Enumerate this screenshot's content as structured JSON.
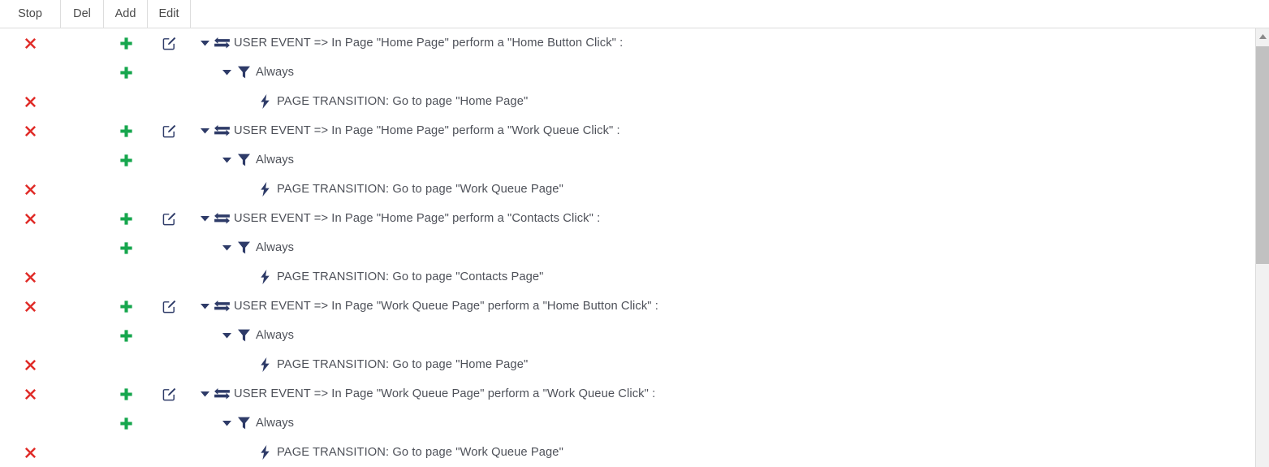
{
  "header": {
    "columns": [
      {
        "label": "Stop",
        "name": "column-header-stop"
      },
      {
        "label": "Del",
        "name": "column-header-del"
      },
      {
        "label": "Add",
        "name": "column-header-add"
      },
      {
        "label": "Edit",
        "name": "column-header-edit"
      }
    ]
  },
  "icons": {
    "delete": "red-x-icon",
    "add": "green-plus-icon",
    "edit": "edit-pencil-icon",
    "caret": "caret-down-icon",
    "event": "exchange-arrows-icon",
    "condition": "filter-funnel-icon",
    "action": "lightning-bolt-icon"
  },
  "colors": {
    "delete": "#e02b27",
    "add": "#16a64d",
    "node": "#2e3b68",
    "text": "#4e5159",
    "header_text": "#4a4a4a",
    "border": "#dddddd",
    "scrollbar_track": "#f1f1f1",
    "scrollbar_thumb": "#c1c1c1"
  },
  "rows": [
    {
      "type": "event",
      "indent": 1,
      "has_stop": true,
      "has_del": false,
      "has_add": true,
      "has_edit": true,
      "text": "USER EVENT => In Page \"Home Page\" perform a \"Home Button Click\" :"
    },
    {
      "type": "condition",
      "indent": 2,
      "has_stop": false,
      "has_del": false,
      "has_add": true,
      "has_edit": false,
      "text": "Always"
    },
    {
      "type": "action",
      "indent": 3,
      "has_stop": true,
      "has_del": false,
      "has_add": false,
      "has_edit": false,
      "text": "PAGE TRANSITION: Go to page \"Home Page\""
    },
    {
      "type": "event",
      "indent": 1,
      "has_stop": true,
      "has_del": false,
      "has_add": true,
      "has_edit": true,
      "text": "USER EVENT => In Page \"Home Page\" perform a \"Work Queue Click\" :"
    },
    {
      "type": "condition",
      "indent": 2,
      "has_stop": false,
      "has_del": false,
      "has_add": true,
      "has_edit": false,
      "text": "Always"
    },
    {
      "type": "action",
      "indent": 3,
      "has_stop": true,
      "has_del": false,
      "has_add": false,
      "has_edit": false,
      "text": "PAGE TRANSITION: Go to page \"Work Queue Page\""
    },
    {
      "type": "event",
      "indent": 1,
      "has_stop": true,
      "has_del": false,
      "has_add": true,
      "has_edit": true,
      "text": "USER EVENT => In Page \"Home Page\" perform a \"Contacts Click\" :"
    },
    {
      "type": "condition",
      "indent": 2,
      "has_stop": false,
      "has_del": false,
      "has_add": true,
      "has_edit": false,
      "text": "Always"
    },
    {
      "type": "action",
      "indent": 3,
      "has_stop": true,
      "has_del": false,
      "has_add": false,
      "has_edit": false,
      "text": "PAGE TRANSITION: Go to page \"Contacts Page\""
    },
    {
      "type": "event",
      "indent": 1,
      "has_stop": true,
      "has_del": false,
      "has_add": true,
      "has_edit": true,
      "text": "USER EVENT => In Page \"Work Queue Page\" perform a \"Home Button Click\" :"
    },
    {
      "type": "condition",
      "indent": 2,
      "has_stop": false,
      "has_del": false,
      "has_add": true,
      "has_edit": false,
      "text": "Always"
    },
    {
      "type": "action",
      "indent": 3,
      "has_stop": true,
      "has_del": false,
      "has_add": false,
      "has_edit": false,
      "text": "PAGE TRANSITION: Go to page \"Home Page\""
    },
    {
      "type": "event",
      "indent": 1,
      "has_stop": true,
      "has_del": false,
      "has_add": true,
      "has_edit": true,
      "text": "USER EVENT => In Page \"Work Queue Page\" perform a \"Work Queue Click\" :"
    },
    {
      "type": "condition",
      "indent": 2,
      "has_stop": false,
      "has_del": false,
      "has_add": true,
      "has_edit": false,
      "text": "Always"
    },
    {
      "type": "action",
      "indent": 3,
      "has_stop": true,
      "has_del": false,
      "has_add": false,
      "has_edit": false,
      "text": "PAGE TRANSITION: Go to page \"Work Queue Page\""
    }
  ],
  "scrollbar": {
    "up_arrow": "scroll-up-arrow",
    "thumb": "scroll-thumb"
  }
}
